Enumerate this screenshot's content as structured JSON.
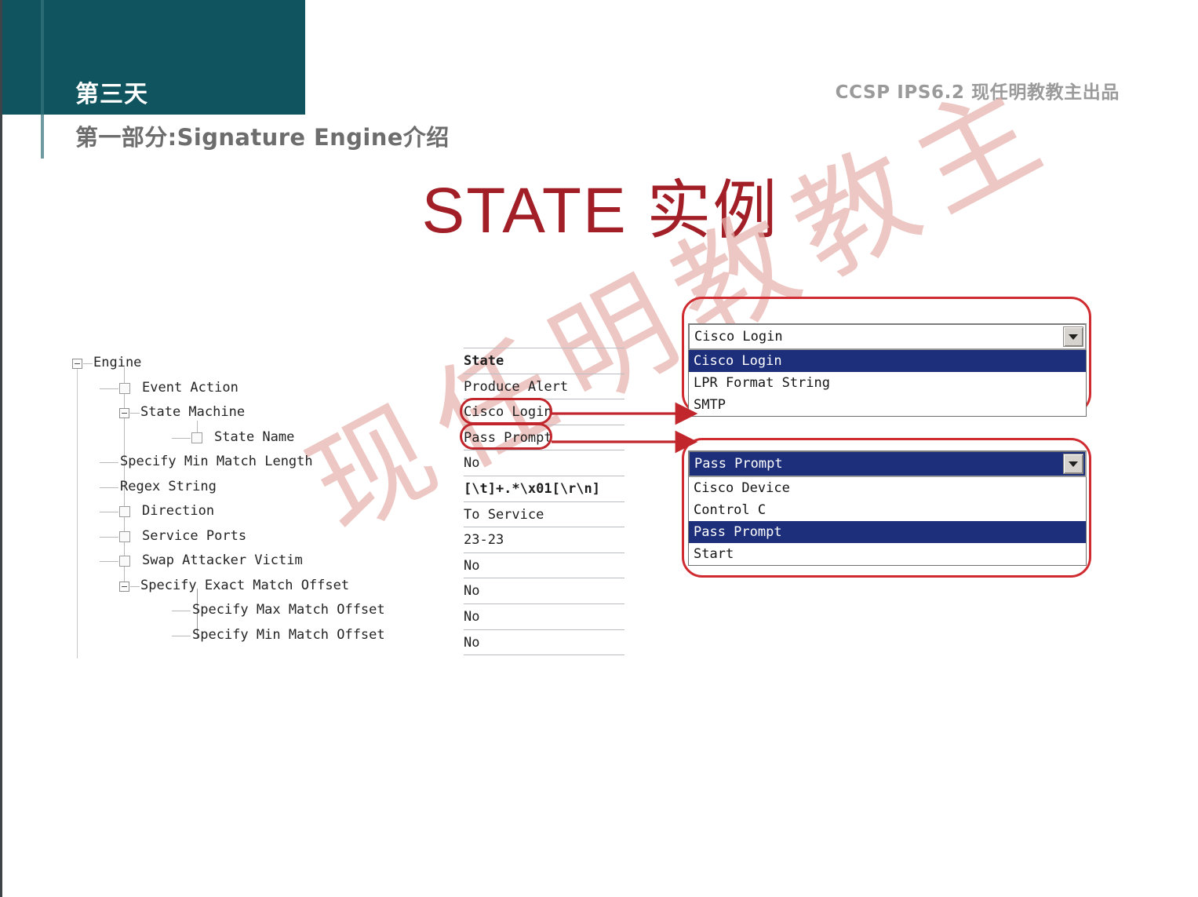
{
  "header": {
    "day_label": "第三天",
    "subtitle": "第一部分:Signature Engine介绍",
    "right_label": "CCSP IPS6.2  现任明教教主出品",
    "teal_color": "#0f545e",
    "accent_color": "#a31f27"
  },
  "title": {
    "latin": "STATE ",
    "cjk": "实例"
  },
  "watermark": {
    "text": "现任明教教主",
    "color": "#e7b2ad"
  },
  "tree": {
    "items": [
      {
        "label": "Engine",
        "indent": 0,
        "marker": "expander-minus"
      },
      {
        "label": "Event Action",
        "indent": 1,
        "marker": "checkbox"
      },
      {
        "label": "State Machine",
        "indent": 1,
        "marker": "expander-minus"
      },
      {
        "label": "State Name",
        "indent": 2,
        "marker": "checkbox"
      },
      {
        "label": "Specify Min Match Length",
        "indent": 1,
        "marker": "none"
      },
      {
        "label": "Regex String",
        "indent": 1,
        "marker": "none"
      },
      {
        "label": "Direction",
        "indent": 1,
        "marker": "checkbox"
      },
      {
        "label": "Service Ports",
        "indent": 1,
        "marker": "checkbox"
      },
      {
        "label": "Swap Attacker Victim",
        "indent": 1,
        "marker": "checkbox"
      },
      {
        "label": "Specify Exact Match Offset",
        "indent": 1,
        "marker": "expander-minus"
      },
      {
        "label": "Specify Max Match Offset",
        "indent": 2,
        "marker": "none"
      },
      {
        "label": "Specify Min Match Offset",
        "indent": 2,
        "marker": "none"
      }
    ]
  },
  "values": {
    "rows": [
      {
        "text": "State",
        "bold": true,
        "circled": false
      },
      {
        "text": "Produce Alert",
        "bold": false,
        "circled": false
      },
      {
        "text": "Cisco Login",
        "bold": false,
        "circled": true
      },
      {
        "text": "Pass Prompt",
        "bold": false,
        "circled": true
      },
      {
        "text": "No",
        "bold": false,
        "circled": false
      },
      {
        "text": "[\\t]+.*\\x01[\\r\\n]",
        "bold": true,
        "circled": false
      },
      {
        "text": "To Service",
        "bold": false,
        "circled": false
      },
      {
        "text": "23-23",
        "bold": false,
        "circled": false
      },
      {
        "text": "No",
        "bold": false,
        "circled": false
      },
      {
        "text": "No",
        "bold": false,
        "circled": false
      },
      {
        "text": "No",
        "bold": false,
        "circled": false
      },
      {
        "text": "No",
        "bold": false,
        "circled": false
      }
    ]
  },
  "dropdown_state_machine": {
    "selected": "Cisco Login",
    "selected_highlighted": false,
    "options": [
      {
        "label": "Cisco Login",
        "highlighted": true
      },
      {
        "label": "LPR Format String",
        "highlighted": false
      },
      {
        "label": "SMTP",
        "highlighted": false
      }
    ]
  },
  "dropdown_state_name": {
    "selected": "Pass Prompt",
    "selected_highlighted": true,
    "options": [
      {
        "label": "Cisco Device",
        "highlighted": false
      },
      {
        "label": "Control C",
        "highlighted": false
      },
      {
        "label": "Pass Prompt",
        "highlighted": true
      },
      {
        "label": "Start",
        "highlighted": false
      }
    ]
  }
}
